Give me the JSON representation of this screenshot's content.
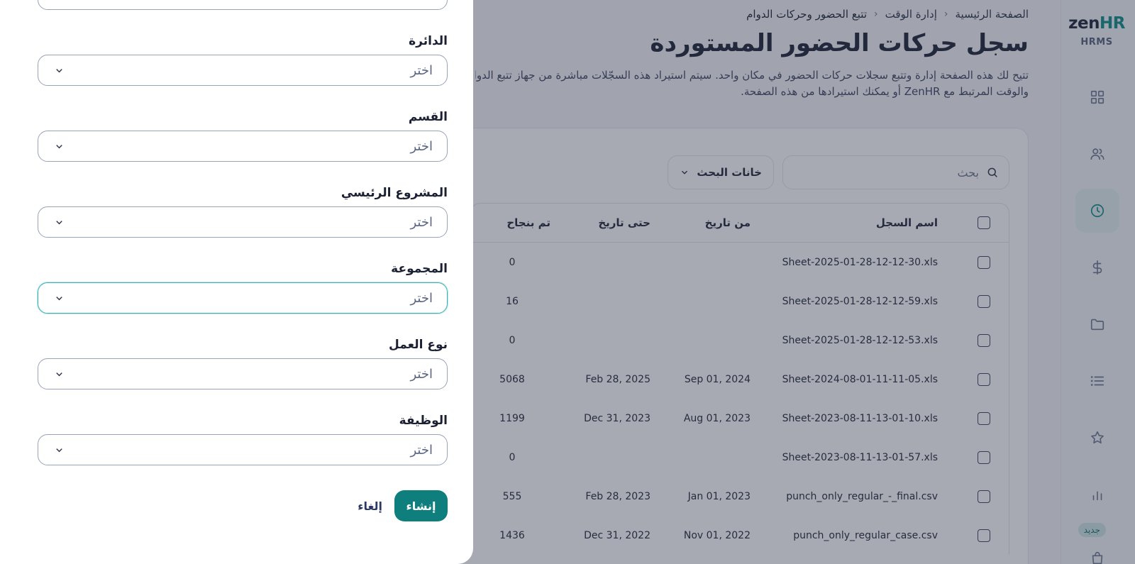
{
  "brand": {
    "logo_main": "zen",
    "logo_accent": "HR",
    "logo_sub": "HRMS",
    "accent_color": "#0b8a88"
  },
  "nav": {
    "items": [
      {
        "icon": "grid-icon"
      },
      {
        "icon": "people-icon"
      },
      {
        "icon": "clock-icon",
        "active": true
      },
      {
        "icon": "dollar-icon"
      },
      {
        "icon": "folder-icon"
      },
      {
        "icon": "list-icon"
      },
      {
        "icon": "star-icon"
      },
      {
        "icon": "bar-chart-icon"
      },
      {
        "icon": "bag-icon"
      }
    ],
    "new_badge": "جديد"
  },
  "breadcrumb": {
    "home": "الصفحة الرئيسية",
    "section": "إدارة الوقت",
    "current": "تتبع الحضور وحركات الدوام"
  },
  "page": {
    "title": "سجل حركات الحضور المستوردة",
    "description_line1": "تتيح لك هذه الصفحة إدارة وتتبع سجلات حركات الحضور في مكان واحد. سيتم استيراد هذه السجّلات مباشرة من جهاز تتبع الدوام",
    "description_line2": "والوقت المرتبط مع ZenHR أو يمكنك استيرادها من هذه الصفحة."
  },
  "search": {
    "placeholder": "بحث",
    "fields_button": "خانات البحث"
  },
  "table": {
    "headers": {
      "name": "اسم السجل",
      "from": "من تاريخ",
      "to": "حتى تاريخ",
      "success": "تم بنجاح"
    },
    "rows": [
      {
        "name": "Sheet-2025-01-28-12-12-30.xls",
        "from": "",
        "to": "",
        "success": "0"
      },
      {
        "name": "Sheet-2025-01-28-12-12-59.xls",
        "from": "",
        "to": "",
        "success": "16"
      },
      {
        "name": "Sheet-2025-01-28-12-12-53.xls",
        "from": "",
        "to": "",
        "success": "0"
      },
      {
        "name": "Sheet-2024-08-01-11-11-05.xls",
        "from": "Sep 01, 2024",
        "to": "Feb 28, 2025",
        "success": "5068"
      },
      {
        "name": "Sheet-2023-08-11-13-01-10.xls",
        "from": "Aug 01, 2023",
        "to": "Dec 31, 2023",
        "success": "1199"
      },
      {
        "name": "Sheet-2023-08-11-13-01-57.xls",
        "from": "",
        "to": "",
        "success": "0"
      },
      {
        "name": "punch_only_regular_-_final.csv",
        "from": "Jan 01, 2023",
        "to": "Feb 28, 2023",
        "success": "555"
      },
      {
        "name": "punch_only_regular_case.csv",
        "from": "Nov 01, 2022",
        "to": "Dec 31, 2022",
        "success": "1436"
      }
    ]
  },
  "drawer": {
    "fields": [
      {
        "label": "الدائرة",
        "placeholder": "اختر"
      },
      {
        "label": "القسم",
        "placeholder": "اختر"
      },
      {
        "label": "المشروع الرئيسي",
        "placeholder": "اختر"
      },
      {
        "label": "المجموعة",
        "placeholder": "اختر",
        "focused": true
      },
      {
        "label": "نوع العمل",
        "placeholder": "اختر"
      },
      {
        "label": "الوظيفة",
        "placeholder": "اختر"
      }
    ],
    "create_button": "إنشاء",
    "cancel_button": "إلغاء"
  }
}
